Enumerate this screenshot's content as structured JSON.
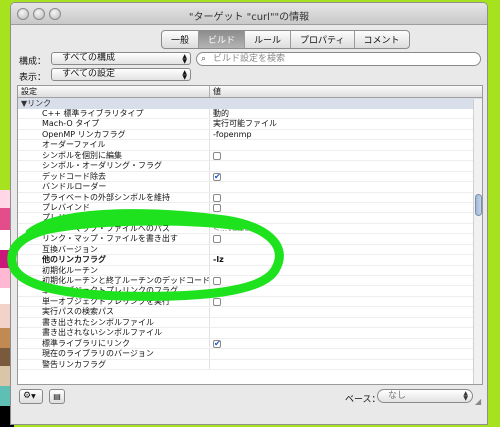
{
  "window": {
    "title": "\"ターゲット \"curl\"\"の情報"
  },
  "tabs": [
    {
      "label": "一般"
    },
    {
      "label": "ビルド",
      "active": true
    },
    {
      "label": "ルール"
    },
    {
      "label": "プロパティ"
    },
    {
      "label": "コメント"
    }
  ],
  "config": {
    "label": "構成：",
    "value": "すべての構成"
  },
  "display": {
    "label": "表示：",
    "value": "すべての設定"
  },
  "search": {
    "placeholder": "ビルド設定を検索"
  },
  "table": {
    "headers": {
      "setting": "設定",
      "value": "値"
    },
    "group": "▼リンク",
    "rows": [
      {
        "name": "C++ 標準ライブラリタイプ",
        "value": "動的",
        "kind": "popup"
      },
      {
        "name": "Mach-O タイプ",
        "value": "実行可能ファイル",
        "kind": "popup"
      },
      {
        "name": "OpenMP リンカフラグ",
        "value": "-fopenmp",
        "kind": "text"
      },
      {
        "name": "オーダーファイル",
        "value": "",
        "kind": "text"
      },
      {
        "name": "シンボルを個別に編集",
        "value": "",
        "kind": "checkbox",
        "checked": false
      },
      {
        "name": "シンボル・オーダリング・フラグ",
        "value": "",
        "kind": "text"
      },
      {
        "name": "デッドコード除去",
        "value": "",
        "kind": "checkbox",
        "checked": true
      },
      {
        "name": "バンドルローダー",
        "value": "",
        "kind": "text"
      },
      {
        "name": "プライベートの外部シンボルを維持",
        "value": "",
        "kind": "checkbox",
        "checked": false
      },
      {
        "name": "プレバインド",
        "value": "",
        "kind": "checkbox",
        "checked": false
      },
      {
        "name": "プレリンクのライブラリ",
        "value": "",
        "kind": "text"
      },
      {
        "name": "リンク・マップ・ファイルへのパス",
        "value": "<...values>",
        "kind": "ghost"
      },
      {
        "name": "リンク・マップ・ファイルを書き出す",
        "value": "",
        "kind": "checkbox",
        "checked": false
      },
      {
        "name": "互換バージョン",
        "value": "",
        "kind": "text"
      },
      {
        "name": "他のリンカフラグ",
        "value": "-lz",
        "kind": "text",
        "bold": true
      },
      {
        "name": "初期化ルーチン",
        "value": "",
        "kind": "text"
      },
      {
        "name": "初期化ルーチンと終了ルーチンのデッドコードを…",
        "value": "",
        "kind": "checkbox",
        "checked": false
      },
      {
        "name": "単一オブジェクトプレリンクのフラグ",
        "value": "",
        "kind": "text"
      },
      {
        "name": "単一オブジェクトプレリンクを実行",
        "value": "",
        "kind": "checkbox",
        "checked": false
      },
      {
        "name": "実行パスの検索パス",
        "value": "",
        "kind": "text"
      },
      {
        "name": "書き出されたシンボルファイル",
        "value": "",
        "kind": "text"
      },
      {
        "name": "書き出されないシンボルファイル",
        "value": "",
        "kind": "text"
      },
      {
        "name": "標準ライブラリにリンク",
        "value": "",
        "kind": "checkbox",
        "checked": true
      },
      {
        "name": "現在のライブラリのバージョン",
        "value": "",
        "kind": "text"
      },
      {
        "name": "警告リンカフラグ",
        "value": "",
        "kind": "text"
      }
    ]
  },
  "footer": {
    "base_label": "ベース：",
    "base_value": "なし"
  },
  "colors": {
    "desktop": "#a6e21e",
    "highlight_stroke": "#1fe21f",
    "checkbox_check": "#1c58c8"
  }
}
